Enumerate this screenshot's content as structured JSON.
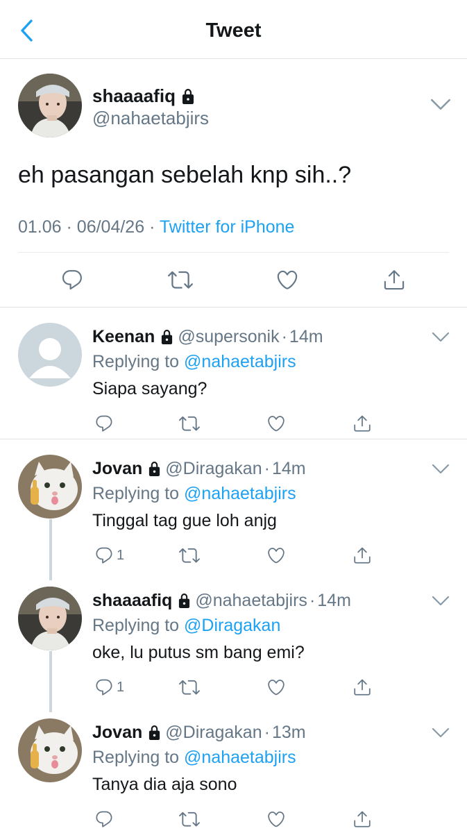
{
  "header": {
    "title": "Tweet"
  },
  "main_tweet": {
    "name": "shaaaafiq",
    "handle": "@nahaetabjirs",
    "text": "eh pasangan sebelah knp sih..?",
    "time": "01.06",
    "date": "06/04/26",
    "source": "Twitter for iPhone",
    "sep": "·"
  },
  "replies": [
    {
      "name": "Keenan",
      "handle": "@supersonik",
      "time": "14m",
      "replying_label": "Replying to",
      "replying_to": "@nahaetabjirs",
      "text": "Siapa sayang?",
      "reply_count": "",
      "avatar": "default-avatar"
    },
    {
      "name": "Jovan",
      "handle": "@Diragakan",
      "time": "14m",
      "replying_label": "Replying to",
      "replying_to": "@nahaetabjirs",
      "text": "Tinggal tag gue loh anjg",
      "reply_count": "1",
      "avatar": "cat-avatar"
    },
    {
      "name": "shaaaafiq",
      "handle": "@nahaetabjirs",
      "time": "14m",
      "replying_label": "Replying to",
      "replying_to": "@Diragakan",
      "text": "oke, lu putus sm bang emi?",
      "reply_count": "1",
      "avatar": "person-avatar"
    },
    {
      "name": "Jovan",
      "handle": "@Diragakan",
      "time": "13m",
      "replying_label": "Replying to",
      "replying_to": "@nahaetabjirs",
      "text": "Tanya dia aja sono",
      "reply_count": "",
      "avatar": "cat-avatar"
    }
  ],
  "colors": {
    "accent": "#1da1f2",
    "secondary_text": "#657786",
    "primary_text": "#14171a",
    "divider": "#dfe3e6",
    "thread_line": "#ccd6dd"
  },
  "icons": {
    "back": "chevron-left-icon",
    "lock": "lock-icon",
    "more": "chevron-down-icon",
    "reply": "reply-icon",
    "retweet": "retweet-icon",
    "like": "heart-icon",
    "share": "share-icon"
  }
}
